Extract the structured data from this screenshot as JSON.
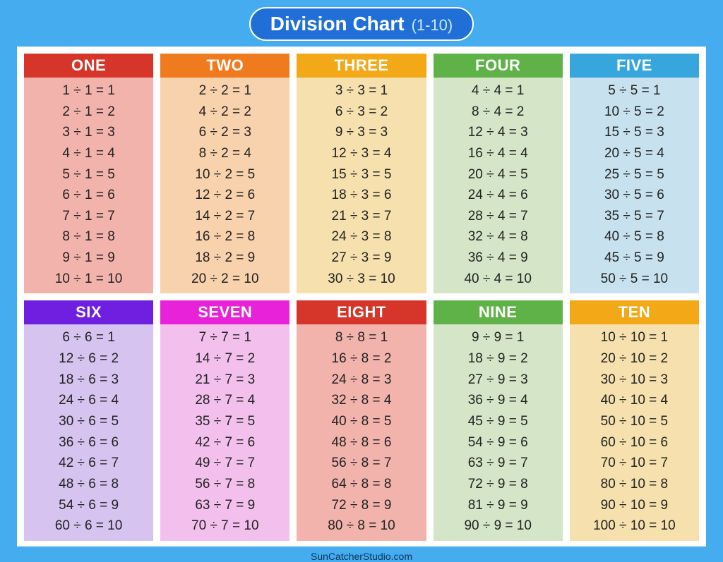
{
  "title": {
    "main": "Division Chart",
    "sub": "(1-10)"
  },
  "footer": "SunCatcherStudio.com",
  "chart_data": {
    "type": "table",
    "title": "Division Chart (1-10)",
    "columns": [
      {
        "label": "ONE",
        "header_bg": "#d6362a",
        "body_bg": "#f2b3ac",
        "divisor": 1,
        "equations": [
          {
            "dividend": 1,
            "divisor": 1,
            "quotient": 1
          },
          {
            "dividend": 2,
            "divisor": 1,
            "quotient": 2
          },
          {
            "dividend": 3,
            "divisor": 1,
            "quotient": 3
          },
          {
            "dividend": 4,
            "divisor": 1,
            "quotient": 4
          },
          {
            "dividend": 5,
            "divisor": 1,
            "quotient": 5
          },
          {
            "dividend": 6,
            "divisor": 1,
            "quotient": 6
          },
          {
            "dividend": 7,
            "divisor": 1,
            "quotient": 7
          },
          {
            "dividend": 8,
            "divisor": 1,
            "quotient": 8
          },
          {
            "dividend": 9,
            "divisor": 1,
            "quotient": 9
          },
          {
            "dividend": 10,
            "divisor": 1,
            "quotient": 10
          }
        ]
      },
      {
        "label": "TWO",
        "header_bg": "#f07a1e",
        "body_bg": "#f8d1ad",
        "divisor": 2,
        "equations": [
          {
            "dividend": 2,
            "divisor": 2,
            "quotient": 1
          },
          {
            "dividend": 4,
            "divisor": 2,
            "quotient": 2
          },
          {
            "dividend": 6,
            "divisor": 2,
            "quotient": 3
          },
          {
            "dividend": 8,
            "divisor": 2,
            "quotient": 4
          },
          {
            "dividend": 10,
            "divisor": 2,
            "quotient": 5
          },
          {
            "dividend": 12,
            "divisor": 2,
            "quotient": 6
          },
          {
            "dividend": 14,
            "divisor": 2,
            "quotient": 7
          },
          {
            "dividend": 16,
            "divisor": 2,
            "quotient": 8
          },
          {
            "dividend": 18,
            "divisor": 2,
            "quotient": 9
          },
          {
            "dividend": 20,
            "divisor": 2,
            "quotient": 10
          }
        ]
      },
      {
        "label": "THREE",
        "header_bg": "#f2a817",
        "body_bg": "#f6e0ae",
        "divisor": 3,
        "equations": [
          {
            "dividend": 3,
            "divisor": 3,
            "quotient": 1
          },
          {
            "dividend": 6,
            "divisor": 3,
            "quotient": 2
          },
          {
            "dividend": 9,
            "divisor": 3,
            "quotient": 3
          },
          {
            "dividend": 12,
            "divisor": 3,
            "quotient": 4
          },
          {
            "dividend": 15,
            "divisor": 3,
            "quotient": 5
          },
          {
            "dividend": 18,
            "divisor": 3,
            "quotient": 6
          },
          {
            "dividend": 21,
            "divisor": 3,
            "quotient": 7
          },
          {
            "dividend": 24,
            "divisor": 3,
            "quotient": 8
          },
          {
            "dividend": 27,
            "divisor": 3,
            "quotient": 9
          },
          {
            "dividend": 30,
            "divisor": 3,
            "quotient": 10
          }
        ]
      },
      {
        "label": "FOUR",
        "header_bg": "#5fb247",
        "body_bg": "#d4e5c8",
        "divisor": 4,
        "equations": [
          {
            "dividend": 4,
            "divisor": 4,
            "quotient": 1
          },
          {
            "dividend": 8,
            "divisor": 4,
            "quotient": 2
          },
          {
            "dividend": 12,
            "divisor": 4,
            "quotient": 3
          },
          {
            "dividend": 16,
            "divisor": 4,
            "quotient": 4
          },
          {
            "dividend": 20,
            "divisor": 4,
            "quotient": 5
          },
          {
            "dividend": 24,
            "divisor": 4,
            "quotient": 6
          },
          {
            "dividend": 28,
            "divisor": 4,
            "quotient": 7
          },
          {
            "dividend": 32,
            "divisor": 4,
            "quotient": 8
          },
          {
            "dividend": 36,
            "divisor": 4,
            "quotient": 9
          },
          {
            "dividend": 40,
            "divisor": 4,
            "quotient": 10
          }
        ]
      },
      {
        "label": "FIVE",
        "header_bg": "#36a6dc",
        "body_bg": "#c7e2ee",
        "divisor": 5,
        "equations": [
          {
            "dividend": 5,
            "divisor": 5,
            "quotient": 1
          },
          {
            "dividend": 10,
            "divisor": 5,
            "quotient": 2
          },
          {
            "dividend": 15,
            "divisor": 5,
            "quotient": 3
          },
          {
            "dividend": 20,
            "divisor": 5,
            "quotient": 4
          },
          {
            "dividend": 25,
            "divisor": 5,
            "quotient": 5
          },
          {
            "dividend": 30,
            "divisor": 5,
            "quotient": 6
          },
          {
            "dividend": 35,
            "divisor": 5,
            "quotient": 7
          },
          {
            "dividend": 40,
            "divisor": 5,
            "quotient": 8
          },
          {
            "dividend": 45,
            "divisor": 5,
            "quotient": 9
          },
          {
            "dividend": 50,
            "divisor": 5,
            "quotient": 10
          }
        ]
      },
      {
        "label": "SIX",
        "header_bg": "#6f1fe0",
        "body_bg": "#d6c3ef",
        "divisor": 6,
        "equations": [
          {
            "dividend": 6,
            "divisor": 6,
            "quotient": 1
          },
          {
            "dividend": 12,
            "divisor": 6,
            "quotient": 2
          },
          {
            "dividend": 18,
            "divisor": 6,
            "quotient": 3
          },
          {
            "dividend": 24,
            "divisor": 6,
            "quotient": 4
          },
          {
            "dividend": 30,
            "divisor": 6,
            "quotient": 5
          },
          {
            "dividend": 36,
            "divisor": 6,
            "quotient": 6
          },
          {
            "dividend": 42,
            "divisor": 6,
            "quotient": 7
          },
          {
            "dividend": 48,
            "divisor": 6,
            "quotient": 8
          },
          {
            "dividend": 54,
            "divisor": 6,
            "quotient": 9
          },
          {
            "dividend": 60,
            "divisor": 6,
            "quotient": 10
          }
        ]
      },
      {
        "label": "SEVEN",
        "header_bg": "#e822d9",
        "body_bg": "#f3c0ee",
        "divisor": 7,
        "equations": [
          {
            "dividend": 7,
            "divisor": 7,
            "quotient": 1
          },
          {
            "dividend": 14,
            "divisor": 7,
            "quotient": 2
          },
          {
            "dividend": 21,
            "divisor": 7,
            "quotient": 3
          },
          {
            "dividend": 28,
            "divisor": 7,
            "quotient": 4
          },
          {
            "dividend": 35,
            "divisor": 7,
            "quotient": 5
          },
          {
            "dividend": 42,
            "divisor": 7,
            "quotient": 6
          },
          {
            "dividend": 49,
            "divisor": 7,
            "quotient": 7
          },
          {
            "dividend": 56,
            "divisor": 7,
            "quotient": 8
          },
          {
            "dividend": 63,
            "divisor": 7,
            "quotient": 9
          },
          {
            "dividend": 70,
            "divisor": 7,
            "quotient": 10
          }
        ]
      },
      {
        "label": "EIGHT",
        "header_bg": "#d6362a",
        "body_bg": "#f2b3ac",
        "divisor": 8,
        "equations": [
          {
            "dividend": 8,
            "divisor": 8,
            "quotient": 1
          },
          {
            "dividend": 16,
            "divisor": 8,
            "quotient": 2
          },
          {
            "dividend": 24,
            "divisor": 8,
            "quotient": 3
          },
          {
            "dividend": 32,
            "divisor": 8,
            "quotient": 4
          },
          {
            "dividend": 40,
            "divisor": 8,
            "quotient": 5
          },
          {
            "dividend": 48,
            "divisor": 8,
            "quotient": 6
          },
          {
            "dividend": 56,
            "divisor": 8,
            "quotient": 7
          },
          {
            "dividend": 64,
            "divisor": 8,
            "quotient": 8
          },
          {
            "dividend": 72,
            "divisor": 8,
            "quotient": 9
          },
          {
            "dividend": 80,
            "divisor": 8,
            "quotient": 10
          }
        ]
      },
      {
        "label": "NINE",
        "header_bg": "#5fb247",
        "body_bg": "#d4e5c8",
        "divisor": 9,
        "equations": [
          {
            "dividend": 9,
            "divisor": 9,
            "quotient": 1
          },
          {
            "dividend": 18,
            "divisor": 9,
            "quotient": 2
          },
          {
            "dividend": 27,
            "divisor": 9,
            "quotient": 3
          },
          {
            "dividend": 36,
            "divisor": 9,
            "quotient": 4
          },
          {
            "dividend": 45,
            "divisor": 9,
            "quotient": 5
          },
          {
            "dividend": 54,
            "divisor": 9,
            "quotient": 6
          },
          {
            "dividend": 63,
            "divisor": 9,
            "quotient": 7
          },
          {
            "dividend": 72,
            "divisor": 9,
            "quotient": 8
          },
          {
            "dividend": 81,
            "divisor": 9,
            "quotient": 9
          },
          {
            "dividend": 90,
            "divisor": 9,
            "quotient": 10
          }
        ]
      },
      {
        "label": "TEN",
        "header_bg": "#f2a817",
        "body_bg": "#f6e0ae",
        "divisor": 10,
        "equations": [
          {
            "dividend": 10,
            "divisor": 10,
            "quotient": 1
          },
          {
            "dividend": 20,
            "divisor": 10,
            "quotient": 2
          },
          {
            "dividend": 30,
            "divisor": 10,
            "quotient": 3
          },
          {
            "dividend": 40,
            "divisor": 10,
            "quotient": 4
          },
          {
            "dividend": 50,
            "divisor": 10,
            "quotient": 5
          },
          {
            "dividend": 60,
            "divisor": 10,
            "quotient": 6
          },
          {
            "dividend": 70,
            "divisor": 10,
            "quotient": 7
          },
          {
            "dividend": 80,
            "divisor": 10,
            "quotient": 8
          },
          {
            "dividend": 90,
            "divisor": 10,
            "quotient": 9
          },
          {
            "dividend": 100,
            "divisor": 10,
            "quotient": 10
          }
        ]
      }
    ]
  }
}
